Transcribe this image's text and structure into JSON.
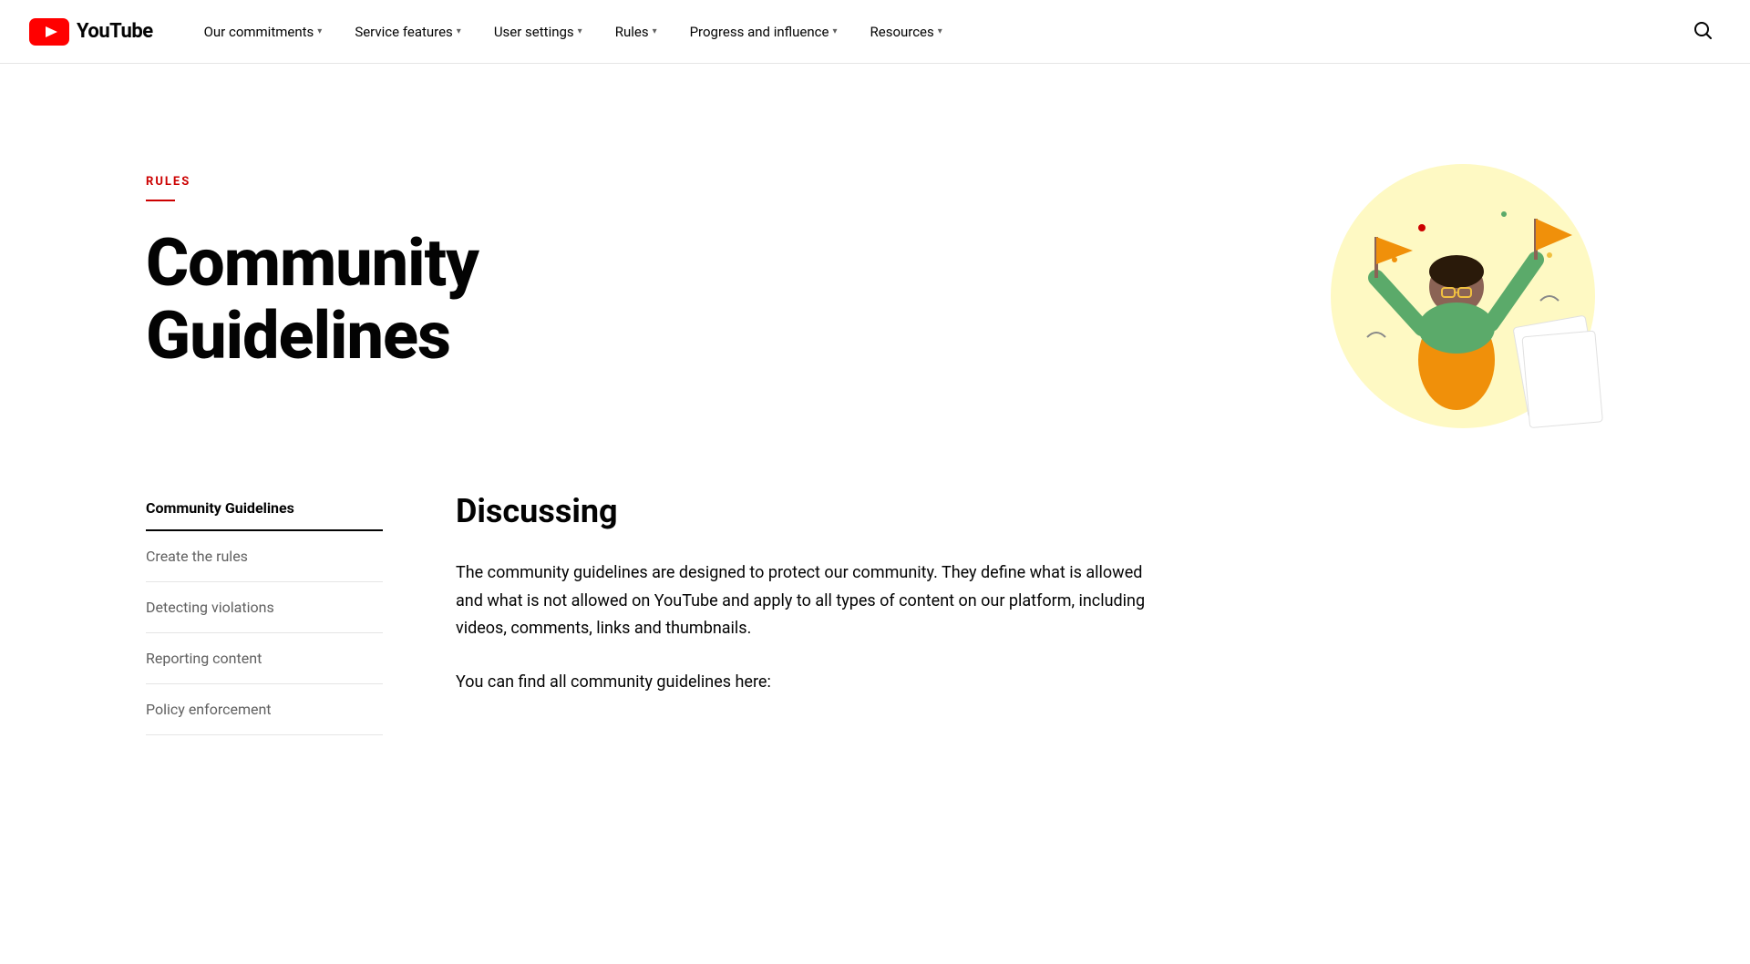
{
  "logo": {
    "text": "YouTube",
    "icon": "youtube-icon"
  },
  "nav": {
    "items": [
      {
        "label": "Our commitments",
        "has_dropdown": true
      },
      {
        "label": "Service features",
        "has_dropdown": true
      },
      {
        "label": "User settings",
        "has_dropdown": true
      },
      {
        "label": "Rules",
        "has_dropdown": true
      },
      {
        "label": "Progress and influence",
        "has_dropdown": true
      },
      {
        "label": "Resources",
        "has_dropdown": true
      }
    ]
  },
  "hero": {
    "tag": "RULES",
    "title": "Community Guidelines"
  },
  "sidebar": {
    "items": [
      {
        "label": "Community Guidelines",
        "active": true
      },
      {
        "label": "Create the rules"
      },
      {
        "label": "Detecting violations"
      },
      {
        "label": "Reporting content"
      },
      {
        "label": "Policy enforcement"
      }
    ]
  },
  "main": {
    "section_title": "Discussing",
    "paragraphs": [
      "The community guidelines are designed to protect our community. They define what is allowed and what is not allowed on YouTube and apply to all types of content on our platform, including videos, comments, links and thumbnails.",
      "You can find all community guidelines here:"
    ]
  }
}
